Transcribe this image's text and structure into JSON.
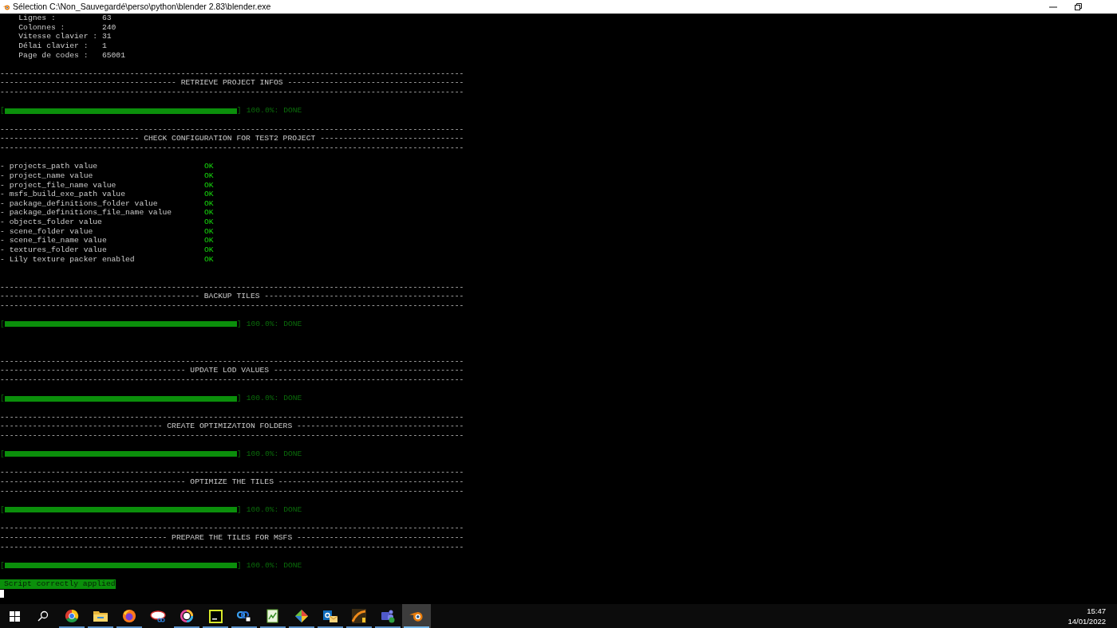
{
  "window": {
    "title": "Sélection C:\\Non_Sauvegardé\\perso\\python\\blender 2.83\\blender.exe"
  },
  "console": [
    {
      "kind": "info",
      "text": "    Lignes :          63"
    },
    {
      "kind": "info",
      "text": "    Colonnes :        240"
    },
    {
      "kind": "info",
      "text": "    Vitesse clavier : 31"
    },
    {
      "kind": "info",
      "text": "    Délai clavier :   1"
    },
    {
      "kind": "info",
      "text": "    Page de codes :   65001"
    },
    {
      "kind": "blank"
    },
    {
      "kind": "rule",
      "text": "----------------------------------------------------------------------------------------------------"
    },
    {
      "kind": "heading",
      "text": "-------------------------------------- RETRIEVE PROJECT INFOS --------------------------------------"
    },
    {
      "kind": "rule",
      "text": "----------------------------------------------------------------------------------------------------"
    },
    {
      "kind": "blank"
    },
    {
      "kind": "progress",
      "left_bracket": "[",
      "right_bracket": "]",
      "level": 1,
      "reading": "100.0%: DONE"
    },
    {
      "kind": "blank"
    },
    {
      "kind": "rule",
      "text": "----------------------------------------------------------------------------------------------------"
    },
    {
      "kind": "heading",
      "text": "------------------------------ CHECK CONFIGURATION FOR TEST2 PROJECT -------------------------------"
    },
    {
      "kind": "rule",
      "text": "----------------------------------------------------------------------------------------------------"
    },
    {
      "kind": "blank"
    },
    {
      "kind": "check",
      "label": "- projects_path value",
      "status": "OK"
    },
    {
      "kind": "check",
      "label": "- project_name value",
      "status": "OK"
    },
    {
      "kind": "check",
      "label": "- project_file_name value",
      "status": "OK"
    },
    {
      "kind": "check",
      "label": "- msfs_build_exe_path value",
      "status": "OK"
    },
    {
      "kind": "check",
      "label": "- package_definitions_folder value",
      "status": "OK"
    },
    {
      "kind": "check",
      "label": "- package_definitions_file_name value",
      "status": "OK"
    },
    {
      "kind": "check",
      "label": "- objects_folder value",
      "status": "OK"
    },
    {
      "kind": "check",
      "label": "- scene_folder value",
      "status": "OK"
    },
    {
      "kind": "check",
      "label": "- scene_file_name value",
      "status": "OK"
    },
    {
      "kind": "check",
      "label": "- textures_folder value",
      "status": "OK"
    },
    {
      "kind": "check",
      "label": "- Lily texture packer enabled",
      "status": "OK"
    },
    {
      "kind": "blank"
    },
    {
      "kind": "blank"
    },
    {
      "kind": "rule",
      "text": "----------------------------------------------------------------------------------------------------"
    },
    {
      "kind": "heading",
      "text": "------------------------------------------- BACKUP TILES -------------------------------------------"
    },
    {
      "kind": "rule",
      "text": "----------------------------------------------------------------------------------------------------"
    },
    {
      "kind": "blank"
    },
    {
      "kind": "progress",
      "left_bracket": "[",
      "right_bracket": "]",
      "level": 1,
      "reading": "100.0%: DONE"
    },
    {
      "kind": "blank"
    },
    {
      "kind": "blank"
    },
    {
      "kind": "blank"
    },
    {
      "kind": "rule",
      "text": "----------------------------------------------------------------------------------------------------"
    },
    {
      "kind": "heading",
      "text": "---------------------------------------- UPDATE LOD VALUES -----------------------------------------"
    },
    {
      "kind": "rule",
      "text": "----------------------------------------------------------------------------------------------------"
    },
    {
      "kind": "blank"
    },
    {
      "kind": "progress",
      "left_bracket": "[",
      "right_bracket": "]",
      "level": 1,
      "reading": "100.0%: DONE"
    },
    {
      "kind": "blank"
    },
    {
      "kind": "rule",
      "text": "----------------------------------------------------------------------------------------------------"
    },
    {
      "kind": "heading",
      "text": "----------------------------------- CREATE OPTIMIZATION FOLDERS ------------------------------------"
    },
    {
      "kind": "rule",
      "text": "----------------------------------------------------------------------------------------------------"
    },
    {
      "kind": "blank"
    },
    {
      "kind": "progress",
      "left_bracket": "[",
      "right_bracket": "]",
      "level": 1,
      "reading": "100.0%: DONE"
    },
    {
      "kind": "blank"
    },
    {
      "kind": "rule",
      "text": "----------------------------------------------------------------------------------------------------"
    },
    {
      "kind": "heading",
      "text": "---------------------------------------- OPTIMIZE THE TILES ----------------------------------------"
    },
    {
      "kind": "rule",
      "text": "----------------------------------------------------------------------------------------------------"
    },
    {
      "kind": "blank"
    },
    {
      "kind": "progress",
      "left_bracket": "[",
      "right_bracket": "]",
      "level": 1,
      "reading": "100.0%: DONE"
    },
    {
      "kind": "blank"
    },
    {
      "kind": "rule",
      "text": "----------------------------------------------------------------------------------------------------"
    },
    {
      "kind": "heading",
      "text": "------------------------------------ PREPARE THE TILES FOR MSFS ------------------------------------"
    },
    {
      "kind": "rule",
      "text": "----------------------------------------------------------------------------------------------------"
    },
    {
      "kind": "blank"
    },
    {
      "kind": "progress",
      "left_bracket": "[",
      "right_bracket": "]",
      "level": 1,
      "reading": "100.0%: DONE"
    },
    {
      "kind": "blank"
    },
    {
      "kind": "message",
      "text": "Script correctly applied"
    },
    {
      "kind": "cursor"
    }
  ],
  "taskbar": {
    "apps": [
      {
        "kind": "start",
        "running": false,
        "selected": false
      },
      {
        "kind": "search",
        "running": false,
        "selected": false
      },
      {
        "kind": "chrome",
        "running": true,
        "selected": false
      },
      {
        "kind": "explorer",
        "running": true,
        "selected": false
      },
      {
        "kind": "firefox",
        "running": true,
        "selected": false
      },
      {
        "kind": "snip",
        "running": false,
        "selected": false
      },
      {
        "kind": "ring",
        "running": true,
        "selected": false
      },
      {
        "kind": "ide",
        "running": true,
        "selected": false
      },
      {
        "kind": "link",
        "running": true,
        "selected": false
      },
      {
        "kind": "notepad",
        "running": true,
        "selected": false
      },
      {
        "kind": "git",
        "running": true,
        "selected": false
      },
      {
        "kind": "mail",
        "running": true,
        "selected": false
      },
      {
        "kind": "curve",
        "running": true,
        "selected": false
      },
      {
        "kind": "teams",
        "running": true,
        "selected": false
      },
      {
        "kind": "blender",
        "running": true,
        "selected": true
      }
    ],
    "time": "15:47",
    "date": "14/01/2022"
  }
}
